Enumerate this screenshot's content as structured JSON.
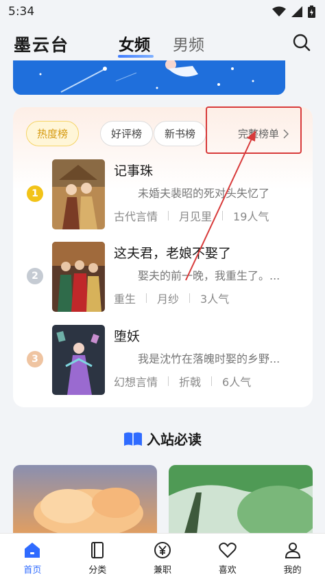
{
  "status_bar": {
    "time": "5:34"
  },
  "header": {
    "brand": "墨云台",
    "tabs": [
      {
        "label": "女频",
        "active": true
      },
      {
        "label": "男频",
        "active": false
      }
    ]
  },
  "rank_card": {
    "chips": [
      "热度榜",
      "好评榜",
      "新书榜"
    ],
    "full_list_label": "完整榜单",
    "books": [
      {
        "rank": "1",
        "title": "记事珠",
        "desc": "未婚夫裴昭的死对头失忆了",
        "genre": "古代言情",
        "author": "月见里",
        "popularity": "19人气",
        "rank_color": "#f2c318"
      },
      {
        "rank": "2",
        "title": "这夫君，老娘不娶了",
        "desc": "娶夫的前一晚，我重生了。...",
        "genre": "重生",
        "author": "月纱",
        "popularity": "3人气",
        "rank_color": "#c5cbd3"
      },
      {
        "rank": "3",
        "title": "堕妖",
        "desc": "我是沈竹在落魄时娶的乡野...",
        "genre": "幻想言情",
        "author": "折戟",
        "popularity": "6人气",
        "rank_color": "#efc4a1"
      }
    ]
  },
  "section": {
    "title": "入站必读"
  },
  "bottom_nav": [
    {
      "label": "首页",
      "icon": "home-icon",
      "active": true
    },
    {
      "label": "分类",
      "icon": "category-icon",
      "active": false
    },
    {
      "label": "兼职",
      "icon": "yen-icon",
      "active": false
    },
    {
      "label": "喜欢",
      "icon": "heart-icon",
      "active": false
    },
    {
      "label": "我的",
      "icon": "profile-icon",
      "active": false
    }
  ],
  "colors": {
    "accent": "#2f6bff",
    "highlight": "#d83a3a",
    "chip_active": "#d69a10"
  }
}
